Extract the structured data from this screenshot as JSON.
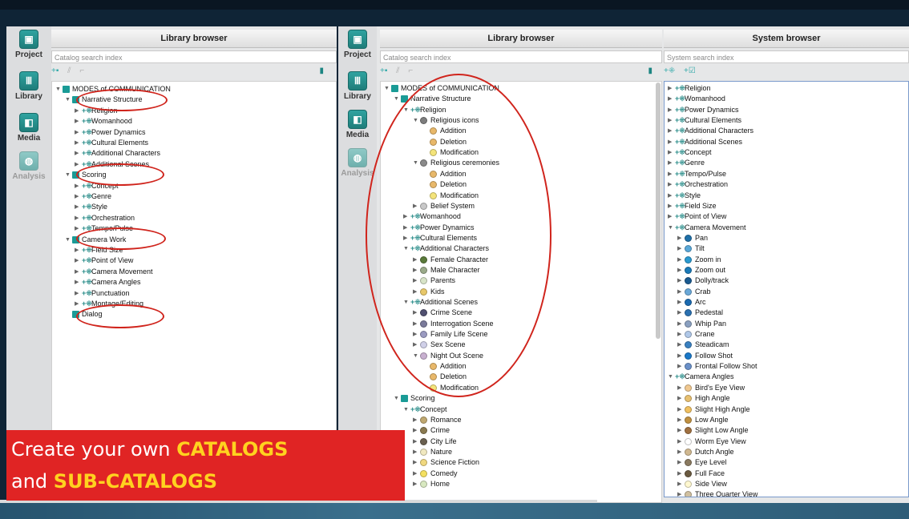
{
  "left_window": {
    "sidebar": [
      {
        "label": "Project",
        "dim": false
      },
      {
        "label": "Library",
        "dim": false
      },
      {
        "label": "Media",
        "dim": false
      },
      {
        "label": "Analysis",
        "dim": true
      }
    ],
    "panel_title": "Library browser",
    "search_placeholder": "Catalog search index",
    "tree": [
      {
        "d": 0,
        "t": "MODES of COMMUNICATION",
        "i": "sq",
        "e": "open"
      },
      {
        "d": 1,
        "t": "Narrative Structure",
        "i": "sq",
        "e": "open"
      },
      {
        "d": 2,
        "t": "Religion",
        "i": "cat",
        "e": "closed"
      },
      {
        "d": 2,
        "t": "Womanhood",
        "i": "cat",
        "e": "closed"
      },
      {
        "d": 2,
        "t": "Power Dynamics",
        "i": "cat",
        "e": "closed"
      },
      {
        "d": 2,
        "t": "Cultural Elements",
        "i": "cat",
        "e": "closed"
      },
      {
        "d": 2,
        "t": "Additional Characters",
        "i": "cat",
        "e": "closed"
      },
      {
        "d": 2,
        "t": "Additional Scenes",
        "i": "cat",
        "e": "closed"
      },
      {
        "d": 1,
        "t": "Scoring",
        "i": "sq",
        "e": "open"
      },
      {
        "d": 2,
        "t": "Concept",
        "i": "cat",
        "e": "closed"
      },
      {
        "d": 2,
        "t": "Genre",
        "i": "cat",
        "e": "closed"
      },
      {
        "d": 2,
        "t": "Style",
        "i": "cat",
        "e": "closed"
      },
      {
        "d": 2,
        "t": "Orchestration",
        "i": "cat",
        "e": "closed"
      },
      {
        "d": 2,
        "t": "Tempo/Pulse",
        "i": "cat",
        "e": "closed"
      },
      {
        "d": 1,
        "t": "Camera Work",
        "i": "sq",
        "e": "open"
      },
      {
        "d": 2,
        "t": "Field Size",
        "i": "cat",
        "e": "closed"
      },
      {
        "d": 2,
        "t": "Point of View",
        "i": "cat",
        "e": "closed"
      },
      {
        "d": 2,
        "t": "Camera Movement",
        "i": "cat",
        "e": "closed"
      },
      {
        "d": 2,
        "t": "Camera Angles",
        "i": "cat",
        "e": "closed"
      },
      {
        "d": 2,
        "t": "Punctuation",
        "i": "cat",
        "e": "closed"
      },
      {
        "d": 2,
        "t": "Montage/Editing",
        "i": "cat",
        "e": "closed"
      },
      {
        "d": 1,
        "t": "Dialog",
        "i": "sq",
        "e": "none"
      }
    ]
  },
  "right_window": {
    "sidebar": [
      {
        "label": "Project",
        "dim": false
      },
      {
        "label": "Library",
        "dim": false
      },
      {
        "label": "Media",
        "dim": false
      },
      {
        "label": "Analysis",
        "dim": true
      }
    ],
    "library": {
      "panel_title": "Library browser",
      "search_placeholder": "Catalog search index",
      "tree": [
        {
          "d": 0,
          "t": "MODES of COMMUNICATION",
          "i": "sq",
          "e": "open"
        },
        {
          "d": 1,
          "t": "Narrative Structure",
          "i": "sq",
          "e": "open"
        },
        {
          "d": 2,
          "t": "Religion",
          "i": "cat",
          "e": "open"
        },
        {
          "d": 3,
          "t": "Religious icons",
          "i": "dot",
          "c": "#7d7d7d",
          "e": "open"
        },
        {
          "d": 4,
          "t": "Addition",
          "i": "dot",
          "c": "#e8b86a",
          "e": "none"
        },
        {
          "d": 4,
          "t": "Deletion",
          "i": "dot",
          "c": "#e8b86a",
          "e": "none"
        },
        {
          "d": 4,
          "t": "Modification",
          "i": "dot",
          "c": "#f4e47a",
          "e": "none"
        },
        {
          "d": 3,
          "t": "Religious ceremonies",
          "i": "dot",
          "c": "#8a8a8a",
          "e": "open"
        },
        {
          "d": 4,
          "t": "Addition",
          "i": "dot",
          "c": "#e8b86a",
          "e": "none"
        },
        {
          "d": 4,
          "t": "Deletion",
          "i": "dot",
          "c": "#e8b86a",
          "e": "none"
        },
        {
          "d": 4,
          "t": "Modification",
          "i": "dot",
          "c": "#f4e47a",
          "e": "none"
        },
        {
          "d": 3,
          "t": "Belief System",
          "i": "dot",
          "c": "#c8c8c8",
          "e": "closed"
        },
        {
          "d": 2,
          "t": "Womanhood",
          "i": "cat",
          "e": "closed"
        },
        {
          "d": 2,
          "t": "Power Dynamics",
          "i": "cat",
          "e": "closed"
        },
        {
          "d": 2,
          "t": "Cultural Elements",
          "i": "cat",
          "e": "closed"
        },
        {
          "d": 2,
          "t": "Additional Characters",
          "i": "cat",
          "e": "open"
        },
        {
          "d": 3,
          "t": "Female Character",
          "i": "dot",
          "c": "#5a7a3a",
          "e": "closed"
        },
        {
          "d": 3,
          "t": "Male Character",
          "i": "dot",
          "c": "#9bab8a",
          "e": "closed"
        },
        {
          "d": 3,
          "t": "Parents",
          "i": "dot",
          "c": "#d8e4c8",
          "e": "closed"
        },
        {
          "d": 3,
          "t": "Kids",
          "i": "dot",
          "c": "#e8c86a",
          "e": "closed"
        },
        {
          "d": 2,
          "t": "Additional Scenes",
          "i": "cat",
          "e": "open"
        },
        {
          "d": 3,
          "t": "Crime Scene",
          "i": "dot",
          "c": "#505070",
          "e": "closed"
        },
        {
          "d": 3,
          "t": "Interrogation Scene",
          "i": "dot",
          "c": "#7a7a9a",
          "e": "closed"
        },
        {
          "d": 3,
          "t": "Family Life Scene",
          "i": "dot",
          "c": "#9a9ac0",
          "e": "closed"
        },
        {
          "d": 3,
          "t": "Sex Scene",
          "i": "dot",
          "c": "#d0d0e8",
          "e": "closed"
        },
        {
          "d": 3,
          "t": "Night Out Scene",
          "i": "dot",
          "c": "#c8b0d0",
          "e": "open"
        },
        {
          "d": 4,
          "t": "Addition",
          "i": "dot",
          "c": "#e8b86a",
          "e": "none"
        },
        {
          "d": 4,
          "t": "Deletion",
          "i": "dot",
          "c": "#e8b86a",
          "e": "none"
        },
        {
          "d": 4,
          "t": "Modification",
          "i": "dot",
          "c": "#f4e47a",
          "e": "none"
        },
        {
          "d": 1,
          "t": "Scoring",
          "i": "sq",
          "e": "open"
        },
        {
          "d": 2,
          "t": "Concept",
          "i": "cat",
          "e": "open"
        },
        {
          "d": 3,
          "t": "Romance",
          "i": "dot",
          "c": "#c0a870",
          "e": "closed"
        },
        {
          "d": 3,
          "t": "Crime",
          "i": "dot",
          "c": "#8a7a50",
          "e": "closed"
        },
        {
          "d": 3,
          "t": "City Life",
          "i": "dot",
          "c": "#6a6050",
          "e": "closed"
        },
        {
          "d": 3,
          "t": "Nature",
          "i": "dot",
          "c": "#f0e8c0",
          "e": "closed"
        },
        {
          "d": 3,
          "t": "Science Fiction",
          "i": "dot",
          "c": "#f0d880",
          "e": "closed"
        },
        {
          "d": 3,
          "t": "Comedy",
          "i": "dot",
          "c": "#f4e060",
          "e": "closed"
        },
        {
          "d": 3,
          "t": "Home",
          "i": "dot",
          "c": "#d8e8c0",
          "e": "closed"
        }
      ]
    },
    "system": {
      "panel_title": "System browser",
      "search_placeholder": "System search index",
      "tree": [
        {
          "d": 0,
          "t": "Religion",
          "i": "cat",
          "e": "closed"
        },
        {
          "d": 0,
          "t": "Womanhood",
          "i": "cat",
          "e": "closed"
        },
        {
          "d": 0,
          "t": "Power Dynamics",
          "i": "cat",
          "e": "closed"
        },
        {
          "d": 0,
          "t": "Cultural Elements",
          "i": "cat",
          "e": "closed"
        },
        {
          "d": 0,
          "t": "Additional Characters",
          "i": "cat",
          "e": "closed"
        },
        {
          "d": 0,
          "t": "Additional Scenes",
          "i": "cat",
          "e": "closed"
        },
        {
          "d": 0,
          "t": "Concept",
          "i": "cat",
          "e": "closed"
        },
        {
          "d": 0,
          "t": "Genre",
          "i": "cat",
          "e": "closed"
        },
        {
          "d": 0,
          "t": "Tempo/Pulse",
          "i": "cat",
          "e": "closed"
        },
        {
          "d": 0,
          "t": "Orchestration",
          "i": "cat",
          "e": "closed"
        },
        {
          "d": 0,
          "t": "Style",
          "i": "cat",
          "e": "closed"
        },
        {
          "d": 0,
          "t": "Field Size",
          "i": "cat",
          "e": "closed"
        },
        {
          "d": 0,
          "t": "Point of View",
          "i": "cat",
          "e": "closed"
        },
        {
          "d": 0,
          "t": "Camera Movement",
          "i": "cat",
          "e": "open"
        },
        {
          "d": 1,
          "t": "Pan",
          "i": "dot",
          "c": "#1f6fa8",
          "e": "closed"
        },
        {
          "d": 1,
          "t": "Tilt",
          "i": "dot",
          "c": "#5aa8d8",
          "e": "closed"
        },
        {
          "d": 1,
          "t": "Zoom in",
          "i": "dot",
          "c": "#2a9ad0",
          "e": "closed"
        },
        {
          "d": 1,
          "t": "Zoom out",
          "i": "dot",
          "c": "#1a7ab8",
          "e": "closed"
        },
        {
          "d": 1,
          "t": "Dolly/track",
          "i": "dot",
          "c": "#1a5a90",
          "e": "closed"
        },
        {
          "d": 1,
          "t": "Crab",
          "i": "dot",
          "c": "#6aa8d8",
          "e": "closed"
        },
        {
          "d": 1,
          "t": "Arc",
          "i": "dot",
          "c": "#1a6ab0",
          "e": "closed"
        },
        {
          "d": 1,
          "t": "Pedestal",
          "i": "dot",
          "c": "#2a70b0",
          "e": "closed"
        },
        {
          "d": 1,
          "t": "Whip Pan",
          "i": "dot",
          "c": "#8aa0c0",
          "e": "closed"
        },
        {
          "d": 1,
          "t": "Crane",
          "i": "dot",
          "c": "#b0c8e8",
          "e": "closed"
        },
        {
          "d": 1,
          "t": "Steadicam",
          "i": "dot",
          "c": "#3a80c0",
          "e": "closed"
        },
        {
          "d": 1,
          "t": "Follow Shot",
          "i": "dot",
          "c": "#1a78c8",
          "e": "closed"
        },
        {
          "d": 1,
          "t": "Frontal Follow Shot",
          "i": "dot",
          "c": "#6a90c8",
          "e": "closed"
        },
        {
          "d": 0,
          "t": "Camera Angles",
          "i": "cat",
          "e": "open"
        },
        {
          "d": 1,
          "t": "Bird's Eye View",
          "i": "dot",
          "c": "#f0c890",
          "e": "closed"
        },
        {
          "d": 1,
          "t": "High Angle",
          "i": "dot",
          "c": "#e8c070",
          "e": "closed"
        },
        {
          "d": 1,
          "t": "Slight High Angle",
          "i": "dot",
          "c": "#f0c060",
          "e": "closed"
        },
        {
          "d": 1,
          "t": "Low Angle",
          "i": "dot",
          "c": "#c09040",
          "e": "closed"
        },
        {
          "d": 1,
          "t": "Slight Low Angle",
          "i": "dot",
          "c": "#a07040",
          "e": "closed"
        },
        {
          "d": 1,
          "t": "Worm Eye View",
          "i": "dot",
          "c": "#ffffff",
          "e": "closed"
        },
        {
          "d": 1,
          "t": "Dutch Angle",
          "i": "dot",
          "c": "#d0b890",
          "e": "closed"
        },
        {
          "d": 1,
          "t": "Eye Level",
          "i": "dot",
          "c": "#8a7a60",
          "e": "closed"
        },
        {
          "d": 1,
          "t": "Full Face",
          "i": "dot",
          "c": "#6a5a40",
          "e": "closed"
        },
        {
          "d": 1,
          "t": "Side View",
          "i": "dot",
          "c": "#fff8d0",
          "e": "closed"
        },
        {
          "d": 1,
          "t": "Three Quarter View",
          "i": "dot",
          "c": "#d0c0a0",
          "e": "closed"
        }
      ]
    }
  },
  "banner": {
    "line1_prefix": "Create your own ",
    "line1_highlight": "CATALOGS",
    "line2_prefix": "and ",
    "line2_highlight": "SUB-CATALOGS"
  },
  "colors": {
    "accent": "#1a9b96",
    "highlight_ellipse": "#d0241c",
    "banner_bg": "#e02424",
    "banner_highlight": "#ffd21f"
  }
}
